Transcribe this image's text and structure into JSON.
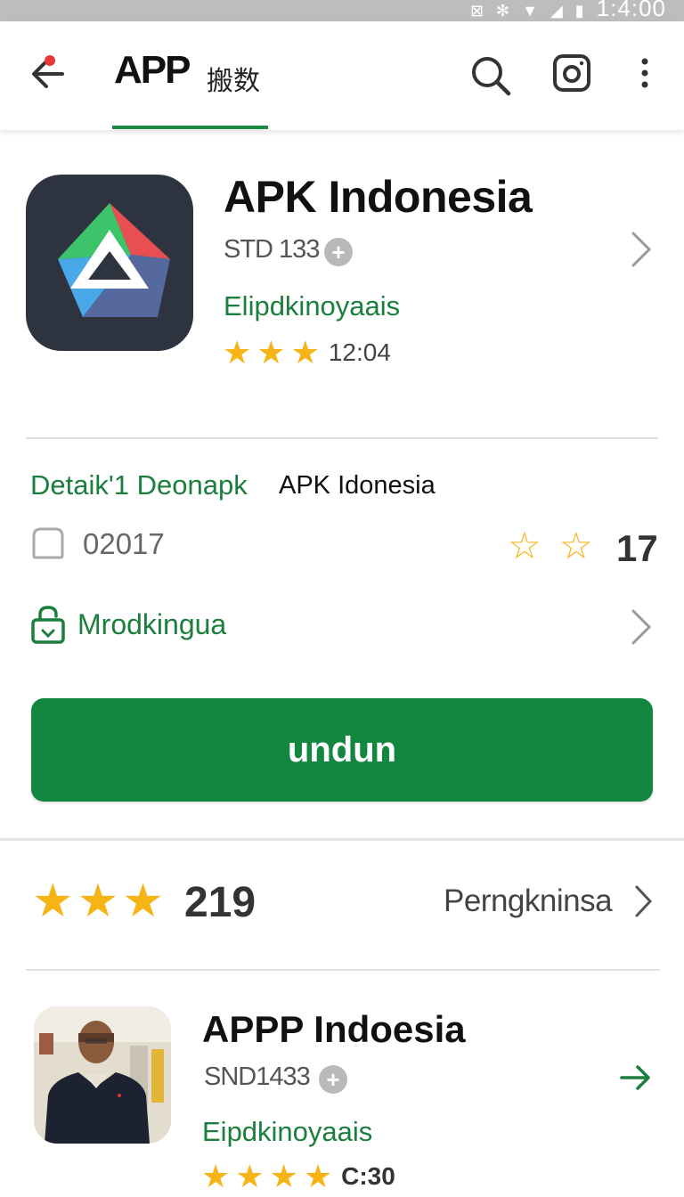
{
  "status_bar": {
    "time": "1:4:00",
    "icons": [
      "nfc-icon",
      "settings-icon",
      "wifi-icon",
      "signal-icon",
      "battery-icon"
    ]
  },
  "app_bar": {
    "title": "APP",
    "title_suffix": "搬数",
    "icons": [
      "back-arrow-icon",
      "search-icon",
      "instagram-icon",
      "more-vert-icon"
    ]
  },
  "app": {
    "name": "APK Indonesia",
    "size": "STD 133",
    "developer": "Elipdkinoyaais",
    "rating_stars": 3,
    "rating_text": "12:04"
  },
  "details": {
    "label": "Detaik'1 Deonapk",
    "value": "APK Idonesia",
    "version": "02017",
    "star_count": 2,
    "star_number": "17",
    "mode_label": "Mrodkingua"
  },
  "download_button": {
    "label": "undun",
    "color": "#13873f"
  },
  "rating_summary": {
    "stars": 3,
    "count": "219",
    "reviews_label": "Perngkninsa"
  },
  "related_app": {
    "name": "APPP Indoesia",
    "size": "SND1433",
    "developer": "Eipdkinoyaais",
    "rating_stars": 4,
    "rating_text": "C:30"
  },
  "colors": {
    "accent_green": "#1a7f3c",
    "star": "#f6b417",
    "status_bar": "#bdbdbd"
  }
}
